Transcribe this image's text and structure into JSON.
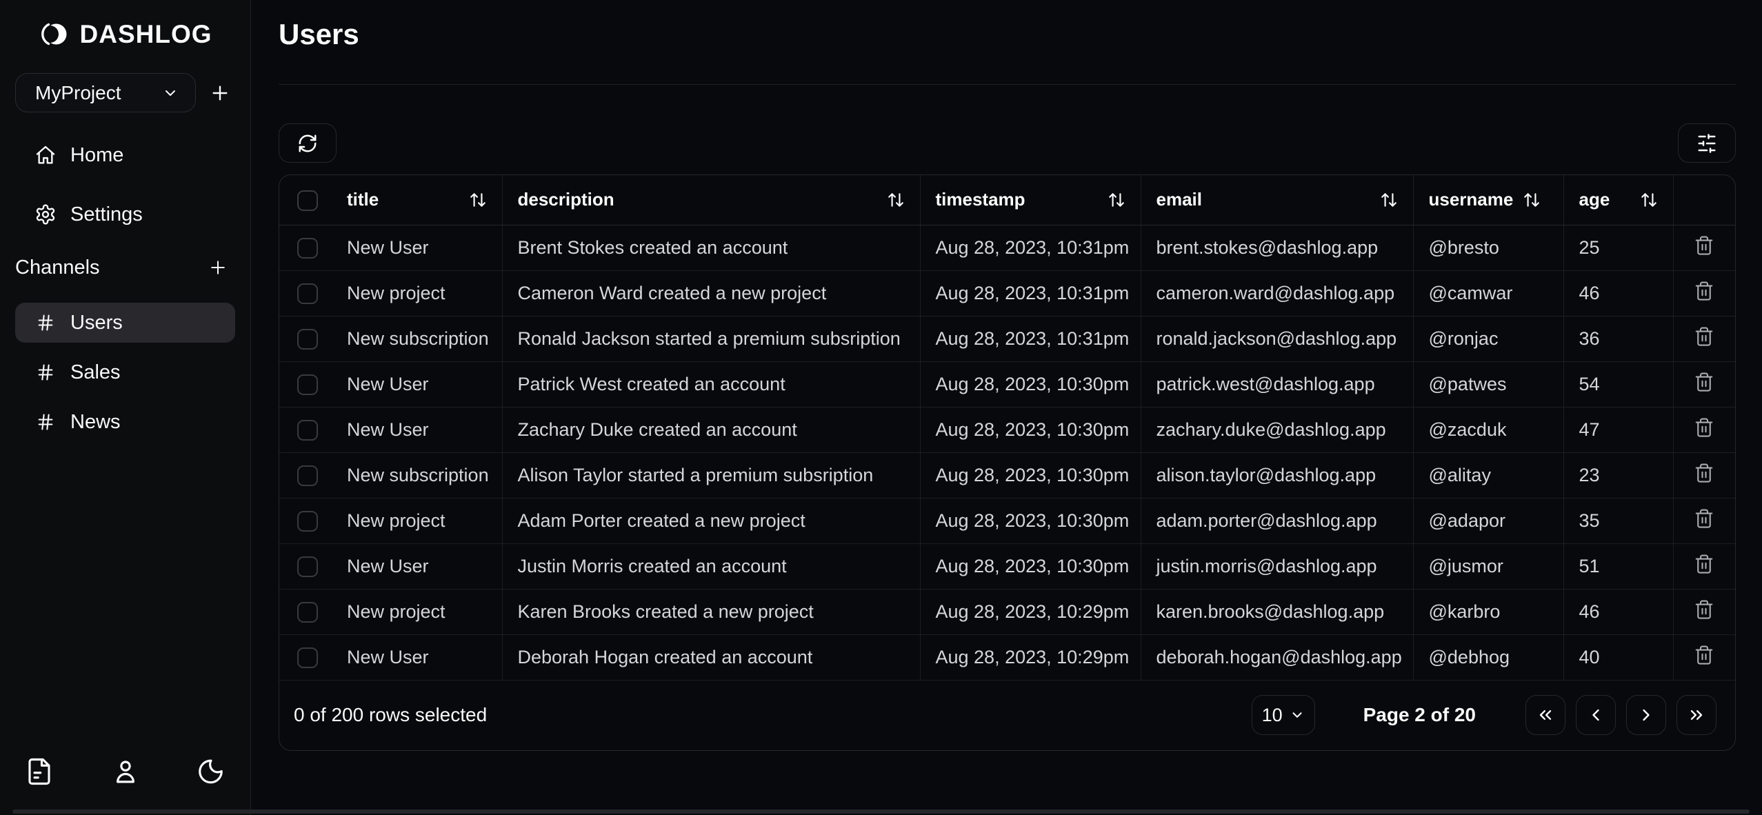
{
  "app": {
    "name": "DASHLOG"
  },
  "sidebar": {
    "project": {
      "value": "MyProject"
    },
    "nav": [
      {
        "label": "Home"
      },
      {
        "label": "Settings"
      }
    ],
    "channels_title": "Channels",
    "channels": [
      {
        "label": "Users",
        "active": true
      },
      {
        "label": "Sales",
        "active": false
      },
      {
        "label": "News",
        "active": false
      }
    ]
  },
  "page": {
    "title": "Users"
  },
  "table": {
    "headers": [
      "title",
      "description",
      "timestamp",
      "email",
      "username",
      "age"
    ],
    "rows": [
      {
        "title": "New User",
        "description": "Brent Stokes created an account",
        "timestamp": "Aug 28, 2023, 10:31pm",
        "email": "brent.stokes@dashlog.app",
        "username": "@bresto",
        "age": "25"
      },
      {
        "title": "New project",
        "description": "Cameron Ward created a new project",
        "timestamp": "Aug 28, 2023, 10:31pm",
        "email": "cameron.ward@dashlog.app",
        "username": "@camwar",
        "age": "46"
      },
      {
        "title": "New subscription",
        "description": "Ronald Jackson started a premium subsription",
        "timestamp": "Aug 28, 2023, 10:31pm",
        "email": "ronald.jackson@dashlog.app",
        "username": "@ronjac",
        "age": "36"
      },
      {
        "title": "New User",
        "description": "Patrick West created an account",
        "timestamp": "Aug 28, 2023, 10:30pm",
        "email": "patrick.west@dashlog.app",
        "username": "@patwes",
        "age": "54"
      },
      {
        "title": "New User",
        "description": "Zachary Duke created an account",
        "timestamp": "Aug 28, 2023, 10:30pm",
        "email": "zachary.duke@dashlog.app",
        "username": "@zacduk",
        "age": "47"
      },
      {
        "title": "New subscription",
        "description": "Alison Taylor started a premium subsription",
        "timestamp": "Aug 28, 2023, 10:30pm",
        "email": "alison.taylor@dashlog.app",
        "username": "@alitay",
        "age": "23"
      },
      {
        "title": "New project",
        "description": "Adam Porter created a new project",
        "timestamp": "Aug 28, 2023, 10:30pm",
        "email": "adam.porter@dashlog.app",
        "username": "@adapor",
        "age": "35"
      },
      {
        "title": "New User",
        "description": "Justin Morris created an account",
        "timestamp": "Aug 28, 2023, 10:30pm",
        "email": "justin.morris@dashlog.app",
        "username": "@jusmor",
        "age": "51"
      },
      {
        "title": "New project",
        "description": "Karen Brooks created a new project",
        "timestamp": "Aug 28, 2023, 10:29pm",
        "email": "karen.brooks@dashlog.app",
        "username": "@karbro",
        "age": "46"
      },
      {
        "title": "New User",
        "description": "Deborah Hogan created an account",
        "timestamp": "Aug 28, 2023, 10:29pm",
        "email": "deborah.hogan@dashlog.app",
        "username": "@debhog",
        "age": "40"
      }
    ],
    "footer": {
      "selection_text": "0 of 200 rows selected",
      "page_size": "10",
      "page_label": "Page 2 of 20"
    }
  },
  "colors": {
    "page_bg": "#08090c",
    "sidebar_bg": "#0c0d0f",
    "active_item_bg": "#28282d",
    "border": "#26272c",
    "cell_text": "#d6d6da"
  }
}
